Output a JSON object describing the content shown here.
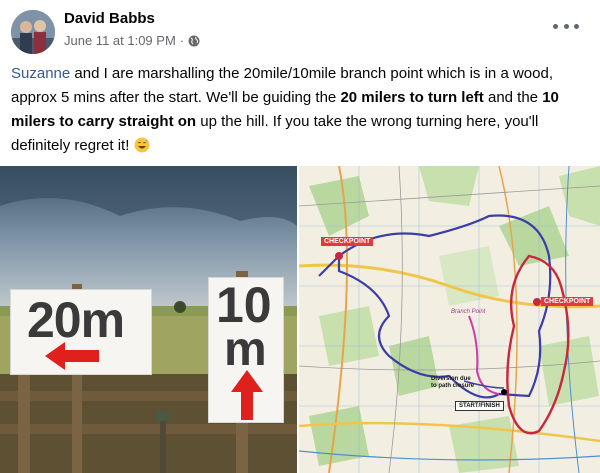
{
  "post": {
    "author": "David Babbs",
    "timestamp": "June 11 at 1:09 PM",
    "separator": "·",
    "audience_icon": "globe-icon",
    "more_icon": "more-options-icon",
    "text": {
      "mention": "Suzanne",
      "part1": " and I are marshalling the 20mile/10mile branch point which is in a wood, approx 5 mins after the start. We'll be guiding the ",
      "bold1": "20 milers to turn left",
      "part2": " and the ",
      "bold2": "10 milers to carry straight on",
      "part3": " up the hill. If you take the wrong turning here, you'll definitely regret it! ",
      "emoji": "grinning-sweat-emoji"
    }
  },
  "photo_left": {
    "sign_20": "20m",
    "sign_10_top": "10",
    "sign_10_bottom": "m"
  },
  "photo_right": {
    "checkpoint_1": "CHECKPOINT",
    "checkpoint_2": "CHECKPOINT",
    "diversion": "Diversion due\nto path closure",
    "start_finish": "START/FINISH",
    "branch_point": "Branch Point"
  },
  "colors": {
    "link": "#385898",
    "meta": "#65676b",
    "checkpoint_bg": "#e03a3a",
    "route_blue": "#3d3da8",
    "route_red": "#c8283c",
    "route_pink": "#d23aa8",
    "arrow_red": "#e0201c"
  }
}
